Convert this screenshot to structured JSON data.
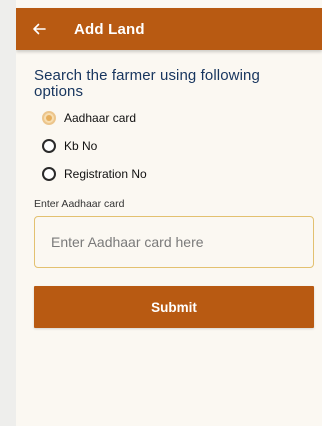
{
  "app_bar": {
    "title": "Add Land",
    "back_icon": "arrow-left-icon",
    "color": "#b85a12"
  },
  "search": {
    "heading": "Search the farmer using following options",
    "options": [
      {
        "label": "Aadhaar card",
        "selected": true
      },
      {
        "label": "Kb No",
        "selected": false
      },
      {
        "label": "Registration No",
        "selected": false
      }
    ]
  },
  "aadhaar_field": {
    "label": "Enter Aadhaar card",
    "value": "",
    "placeholder": "Enter Aadhaar card here"
  },
  "submit": {
    "label": "Submit"
  },
  "colors": {
    "accent": "#b85a12",
    "heading": "#17355e",
    "radio_selected": "#e7ae5c",
    "input_border": "#e3c170"
  }
}
